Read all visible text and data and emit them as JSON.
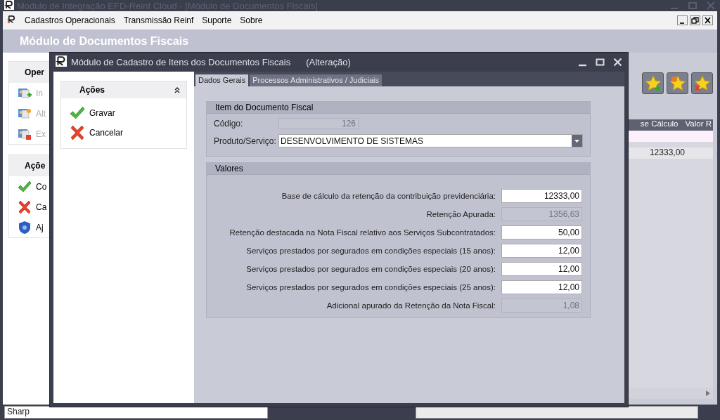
{
  "app_window": {
    "title": "Modulo de Integração EFD-Reinf Cloud - [Módulo de Documentos Fiscais]",
    "menu": [
      "Cadastros Operacionais",
      "Transmissão Reinf",
      "Suporte",
      "Sobre"
    ],
    "header": "Módulo de Documentos Fiscais",
    "operations_panel": {
      "title": "Oper",
      "items": [
        {
          "kind": "add",
          "label": "In"
        },
        {
          "kind": "edit",
          "label": "Alt"
        },
        {
          "kind": "delete",
          "label": "Ex"
        }
      ]
    },
    "actions_panel": {
      "title": "Açõe",
      "items": [
        {
          "kind": "confirm",
          "label": "Co"
        },
        {
          "kind": "cancel",
          "label": "Ca"
        },
        {
          "kind": "help",
          "label": "Aj"
        }
      ]
    },
    "toolbar": [
      {
        "kind": "add"
      },
      {
        "kind": "edit"
      },
      {
        "kind": "delete"
      }
    ],
    "table": {
      "columns": [
        "se Cálculo",
        "Valor R"
      ],
      "rows": [
        {
          "cells": [
            "12333,00"
          ]
        }
      ]
    },
    "status_bar": {
      "field": "Sharp"
    }
  },
  "dialog": {
    "title": "Módulo de Cadastro de Itens dos Documentos Fiscais",
    "mode": "(Alteração)",
    "side_panel": {
      "title": "Ações",
      "expanded": true,
      "items": [
        {
          "kind": "save",
          "label": "Gravar"
        },
        {
          "kind": "cancel",
          "label": "Cancelar"
        }
      ]
    },
    "tabs": [
      {
        "label": "Dados Gerais",
        "selected": true
      },
      {
        "label": "Processos Administrativos / Judiciais",
        "selected": false
      }
    ],
    "item_group": {
      "title": "Item do Documento Fiscal",
      "code": {
        "label": "Código:",
        "value": "126",
        "disabled": true
      },
      "product": {
        "label": "Produto/Serviço:",
        "value": "DESENVOLVIMENTO DE SISTEMAS"
      }
    },
    "values_group": {
      "title": "Valores",
      "fields": [
        {
          "label": "Base de cálculo da retenção da contribuição previdenciária:",
          "value": "12333,00",
          "disabled": false
        },
        {
          "label": "Retenção Apurada:",
          "value": "1356,63",
          "disabled": true
        },
        {
          "label": "Retenção destacada na Nota Fiscal relativo aos Serviços Subcontratados:",
          "value": "50,00",
          "disabled": false
        },
        {
          "label": "Serviços prestados por segurados em condições especiais (15 anos):",
          "value": "12,00",
          "disabled": false
        },
        {
          "label": "Serviços prestados por segurados em condições especiais (20 anos):",
          "value": "12,00",
          "disabled": false
        },
        {
          "label": "Serviços prestados por segurados em condições especiais (25 anos):",
          "value": "12,00",
          "disabled": false
        },
        {
          "label": "Adicional apurado da Retenção da Nota Fiscal:",
          "value": "1,08",
          "disabled": true
        }
      ]
    }
  }
}
